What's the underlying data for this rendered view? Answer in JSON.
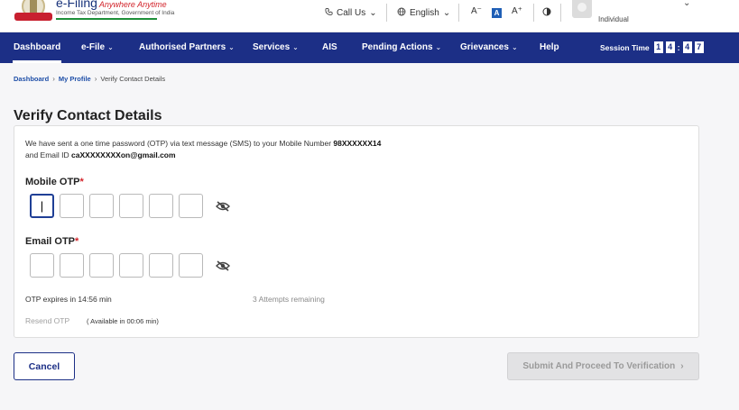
{
  "header": {
    "brand_name": "e-Filing",
    "brand_tagline": "Anywhere Anytime",
    "brand_sub": "Income Tax Department, Government of India",
    "call_us": "Call Us",
    "language": "English",
    "font_decrease": "A⁻",
    "font_default": "A",
    "font_increase": "A⁺",
    "role": "Individual"
  },
  "nav": {
    "items": [
      {
        "label": "Dashboard",
        "dropdown": false
      },
      {
        "label": "e-File",
        "dropdown": true
      },
      {
        "label": "Authorised Partners",
        "dropdown": true
      },
      {
        "label": "Services",
        "dropdown": true
      },
      {
        "label": "AIS",
        "dropdown": false
      },
      {
        "label": "Pending Actions",
        "dropdown": true
      },
      {
        "label": "Grievances",
        "dropdown": true
      },
      {
        "label": "Help",
        "dropdown": false
      }
    ],
    "session_label": "Session Time",
    "session_digits": [
      "1",
      "4",
      "4",
      "7"
    ]
  },
  "breadcrumb": {
    "items": [
      "Dashboard",
      "My Profile"
    ],
    "current": "Verify Contact Details"
  },
  "page": {
    "title": "Verify Contact Details",
    "message_line1": "We have sent a one time password (OTP) via text message (SMS) to your Mobile Number ",
    "mobile_number": "98XXXXXX14",
    "message_line2": "and Email ID ",
    "email_id": "caXXXXXXXXon@gmail.com",
    "mobile_otp_label": "Mobile OTP",
    "email_otp_label": "Email OTP",
    "required_mark": "*",
    "mobile_otp_value": "|",
    "otp_expiry": "OTP expires in 14:56 min",
    "attempts": "3 Attempts remaining",
    "resend": "Resend OTP",
    "resend_available": "( Available in 00:06 min)"
  },
  "actions": {
    "cancel_label": "Cancel",
    "submit_label": "Submit And Proceed To Verification",
    "submit_arrow": "›"
  },
  "colors": {
    "nav_bg": "#1c2f86",
    "required": "#d2232a",
    "disabled_btn": "#e2e2e4"
  }
}
